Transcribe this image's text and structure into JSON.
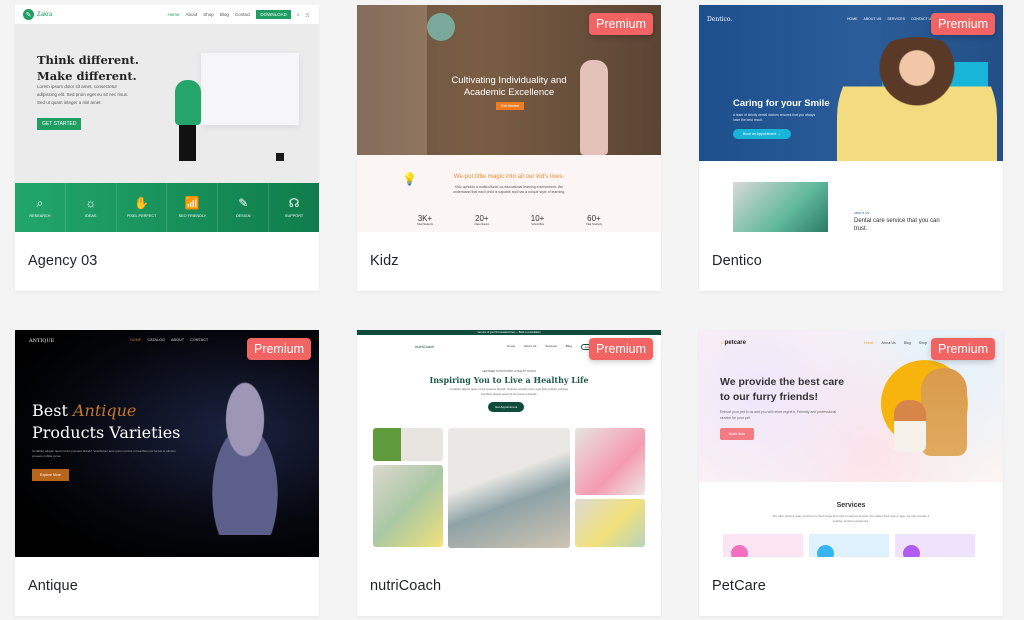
{
  "badge_label": "Premium",
  "cards": [
    {
      "title": "Agency 03",
      "premium": false,
      "preview": {
        "brand": "Zakra",
        "nav": [
          "Home",
          "About",
          "Shop",
          "Blog",
          "Contact"
        ],
        "nav_button": "DOWNLOAD",
        "heading_line1": "Think different.",
        "heading_line2": "Make different.",
        "paragraph": "Lorem ipsum dolor sit amet, consectetur adipiscing elit. Sed proin eget eu sit nec risus. Sed ut quam integer a nisl amet.",
        "cta": "GET STARTED",
        "features": [
          {
            "icon": "search-icon",
            "glyph": "⌕",
            "label": "RESEARCH"
          },
          {
            "icon": "lightbulb-icon",
            "glyph": "☼",
            "label": "IDEAS"
          },
          {
            "icon": "hand-icon",
            "glyph": "✋",
            "label": "PIXEL PERFECT"
          },
          {
            "icon": "chart-icon",
            "glyph": "📶",
            "label": "SEO FRIENDLY"
          },
          {
            "icon": "pen-icon",
            "glyph": "✎",
            "label": "DESIGN"
          },
          {
            "icon": "headset-icon",
            "glyph": "☊",
            "label": "SUPPORT"
          }
        ]
      }
    },
    {
      "title": "Kidz",
      "premium": true,
      "preview": {
        "heading_line1": "Cultivating Individuality and",
        "heading_line2": "Academic Excellence",
        "cta": "Get Started",
        "section_title": "We put little magic into all our kid's lives.",
        "section_text": "Kidz upholds a multicultural, co-educational learning environment. We understand that each child is capable and has a unique style of learning.",
        "stats": [
          {
            "value": "3K+",
            "label": "Total Students"
          },
          {
            "value": "20+",
            "label": "Class Rooms"
          },
          {
            "value": "10+",
            "label": "School Bus"
          },
          {
            "value": "60+",
            "label": "Total Teachers"
          }
        ]
      }
    },
    {
      "title": "Dentico",
      "premium": true,
      "preview": {
        "brand": "Dentico.",
        "nav": [
          "HOME",
          "ABOUT US",
          "SERVICES",
          "CONTACT US"
        ],
        "heading": "Caring for your Smile",
        "paragraph": "A team of strictly dental doctors ensures that you always have the best result.",
        "cta": "Book an Appointment →",
        "about_label": "ABOUT US",
        "about_heading": "Dental care service that you can trust."
      }
    },
    {
      "title": "Antique",
      "premium": true,
      "preview": {
        "brand": "ANTIQUE",
        "nav": [
          "HOME",
          "CATALOG",
          "ABOUT",
          "CONTACT"
        ],
        "heading_word1": "Best",
        "heading_accent": "Antique",
        "heading_line2": "Products Varieties",
        "paragraph": "Curabitur aliquet quam id dui posuere blandit. Vestibulum ante ipsum primis in faucibus orci luctus et ultrices posuere cubilia curae.",
        "cta": "Explore More"
      }
    },
    {
      "title": "nutriCoach",
      "premium": true,
      "preview": {
        "top_bar": "Get one of your first sessions free — Book a consultation",
        "brand": "nutriCoach",
        "nav": [
          "Home",
          "About Us",
          "Services",
          "Blog"
        ],
        "nav_button": "Let's Talk",
        "subheading": "CERTIFIED NUTRITIONIST & HEALTH COACH",
        "heading": "Inspiring You to Live a Healthy Life",
        "paragraph": "Curabitur aliquet quam id dui posuere blandit. Vivamus suscipit tortor eget felis porttitor volutpat. Curabitur aliquet quam id dui posuere blandit.",
        "cta": "Get Appointment"
      }
    },
    {
      "title": "PetCare",
      "premium": true,
      "preview": {
        "brand_prefix": "pet",
        "brand_suffix": "care",
        "nav": [
          "Home",
          "About Us",
          "Blog",
          "Shop"
        ],
        "heading_line1": "We provide the best care",
        "heading_line2": "to our furry friends!",
        "paragraph": "Entrust your pet to us and you will never regret it. Friendly and professional service for your pet.",
        "cta": "Book Now",
        "services_title": "Services",
        "services_text": "We offer quick & easy services for both dogs and cats of various breeds. No matter their size or age, we can provide a positive service experience."
      }
    }
  ],
  "colors": {
    "badge": "#f26464",
    "agency_green": "#1f9d63",
    "kidz_orange": "#ef8a3a",
    "dentico_blue": "#1d4f8c",
    "antique_bronze": "#c4762a",
    "nutri_green": "#0f4d3a",
    "petcare_yellow": "#f6b40d"
  }
}
